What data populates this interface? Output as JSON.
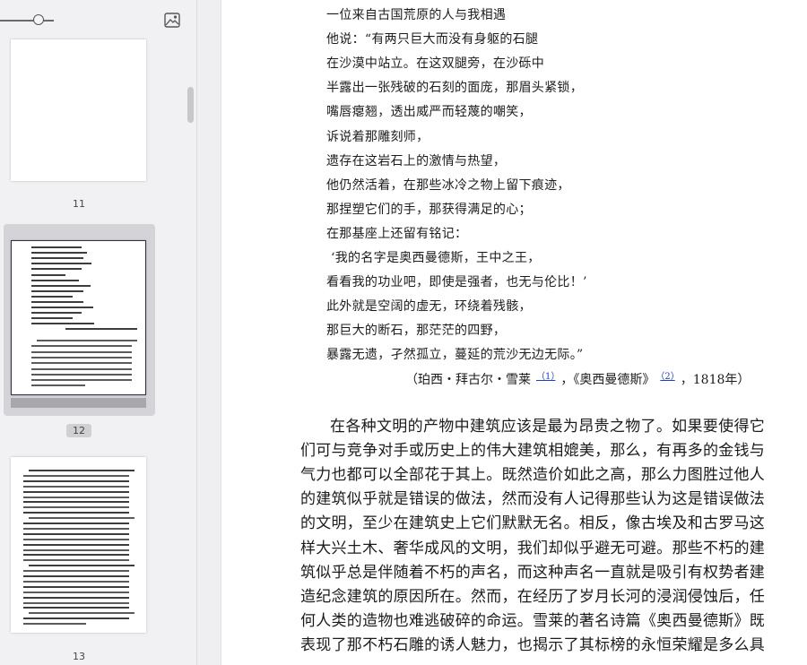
{
  "sidebar": {
    "thumbnails": [
      {
        "page_label": "11",
        "selected": false
      },
      {
        "page_label": "12",
        "selected": true
      },
      {
        "page_label": "13",
        "selected": false
      }
    ],
    "zoom_level": 0.62,
    "image_icon": "image-icon"
  },
  "document": {
    "poem": [
      "一位来自古国荒原的人与我相遇",
      "他说：“有两只巨大而没有身躯的石腿",
      "在沙漠中站立。在这双腿旁，在沙砾中",
      "半露出一张残破的石刻的面庞，那眉头紧锁，",
      "嘴唇瘪翘，透出威严而轻蔑的嘲笑，",
      "诉说着那雕刻师，",
      "遗存在这岩石上的激情与热望，",
      "他仍然活着，在那些冰冷之物上留下痕迹，",
      "那捏塑它们的手，那获得满足的心；",
      "在那基座上还留有铭记：",
      "‘我的名字是奥西曼德斯，王中之王，",
      "看看我的功业吧，即使是强者，也无与伦比！’",
      "此外就是空阔的虚无，环绕着残骸，",
      "那巨大的断石，那茫茫的四野，",
      "暴露无遗，孑然孤立，蔓延的荒沙无边无际。”"
    ],
    "attribution": {
      "prefix": "（珀西・拜古尔・雪莱",
      "note1": "（1）",
      "middle": "，《奥西曼德斯》",
      "note2": "（2）",
      "suffix": "，1818年）"
    },
    "paragraph": [
      "在各种文明的产物中建筑应该是最为昂贵之物了。如果要使得它",
      "们可与竞争对手或历史上的伟大建筑相媲美，那么，有再多的金钱与",
      "气力也都可以全部花于其上。既然造价如此之高，那么力图胜过他人",
      "的建筑似乎就是错误的做法，然而没有人记得那些认为这是错误做法",
      "的文明，至少在建筑史上它们默默无名。相反，像古埃及和古罗马这",
      "样大兴土木、奢华成风的文明，我们却似乎避无可避。那些不朽的建",
      "筑似乎总是伴随着不朽的声名，而这种声名一直就是吸引有权势者建",
      "造纪念建筑的原因所在。然而，在经历了岁月长河的浸润侵蚀后，任",
      "何人类的造物也难逃破碎的命运。雪莱的著名诗篇《奥西曼德斯》既",
      "表现了那不朽石雕的诱人魅力，也揭示了其标榜的永恒荣耀是多么具"
    ]
  }
}
